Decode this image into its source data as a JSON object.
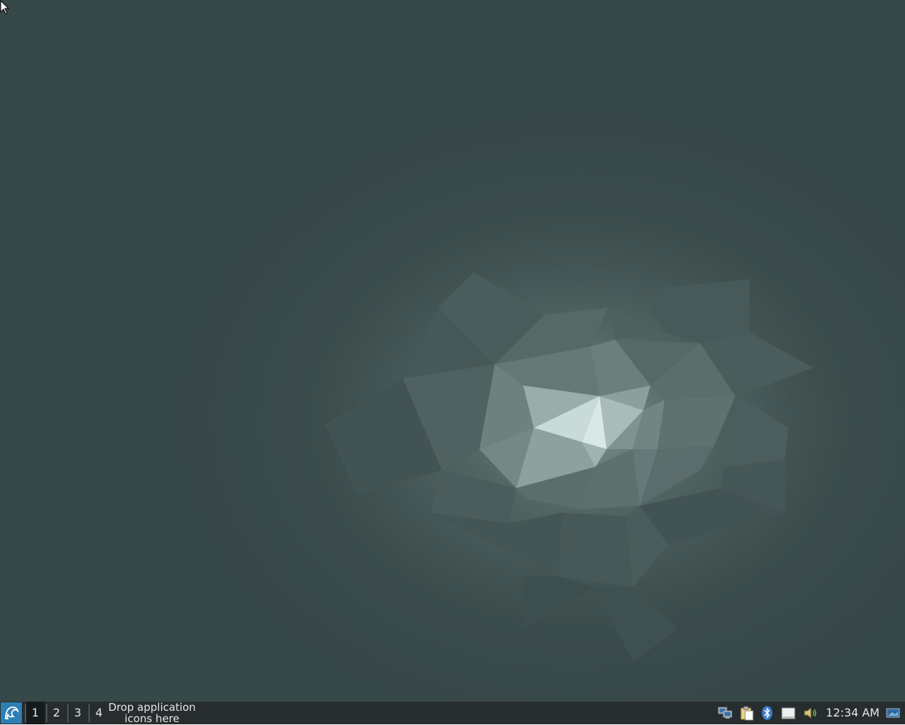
{
  "desktop": {
    "wallpaper": "low-poly-gray-wallpaper",
    "colors": {
      "background": "#364646",
      "taskbar": "#272d2e",
      "accent": "#2d7fb5"
    }
  },
  "taskbar": {
    "start_icon": "start-menu-icon",
    "workspaces": [
      "1",
      "2",
      "3",
      "4"
    ],
    "active_workspace": "1",
    "launcher_line1": "Drop application",
    "launcher_line2": "icons here",
    "tray": {
      "icons": [
        "network-icon",
        "clipboard-icon",
        "bluetooth-icon",
        "removable-drive-icon",
        "volume-icon"
      ],
      "clock": "12:34 AM",
      "show_desktop_icon": "show-desktop-icon"
    }
  }
}
